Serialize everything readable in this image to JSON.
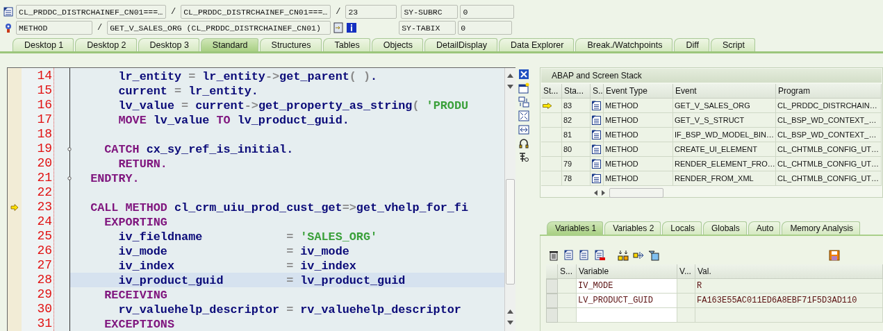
{
  "header_rows": [
    {
      "cells": [
        {
          "kind": "field",
          "text": "CL_PRDDC_DISTRCHAINEF_CN01===…"
        },
        {
          "kind": "separator",
          "text": "/"
        },
        {
          "kind": "field",
          "text": "CL_PRDDC_DISTRCHAINEF_CN01===…"
        },
        {
          "kind": "separator",
          "text": "/"
        },
        {
          "kind": "numberfield",
          "text": "23"
        }
      ],
      "sys_name": "SY-SUBRC",
      "sys_value": "0"
    },
    {
      "cells": [
        {
          "kind": "shortfield",
          "text": "METHOD"
        },
        {
          "kind": "separator",
          "text": "/"
        },
        {
          "kind": "longfield",
          "text": "GET_V_SALES_ORG (CL_PRDDC_DISTRCHAINEF_CN01)"
        }
      ],
      "sys_name": "SY-TABIX",
      "sys_value": "0"
    }
  ],
  "desktop_tabs": [
    {
      "label": "Desktop 1",
      "selected": false
    },
    {
      "label": "Desktop 2",
      "selected": false
    },
    {
      "label": "Desktop 3",
      "selected": false
    },
    {
      "label": "Standard",
      "selected": true
    },
    {
      "label": "Structures",
      "selected": false
    },
    {
      "label": "Tables",
      "selected": false
    },
    {
      "label": "Objects",
      "selected": false
    },
    {
      "label": "DetailDisplay",
      "selected": false
    },
    {
      "label": "Data Explorer",
      "selected": false
    },
    {
      "label": "Break./Watchpoints",
      "selected": false
    },
    {
      "label": "Diff",
      "selected": false
    },
    {
      "label": "Script",
      "selected": false
    }
  ],
  "code_lines": [
    {
      "number": "14",
      "current": false,
      "selected": false,
      "fold": false,
      "tokens": [
        {
          "kind": "id",
          "text": "      lr_entity "
        },
        {
          "kind": "op",
          "text": "= "
        },
        {
          "kind": "id",
          "text": "lr_entity"
        },
        {
          "kind": "op",
          "text": "->"
        },
        {
          "kind": "id",
          "text": "get_parent"
        },
        {
          "kind": "op",
          "text": "( )"
        },
        {
          "kind": "id",
          "text": "."
        }
      ]
    },
    {
      "number": "15",
      "current": false,
      "selected": false,
      "fold": false,
      "tokens": [
        {
          "kind": "id",
          "text": "      current "
        },
        {
          "kind": "op",
          "text": "= "
        },
        {
          "kind": "id",
          "text": "lr_entity."
        }
      ]
    },
    {
      "number": "16",
      "current": false,
      "selected": false,
      "fold": false,
      "tokens": [
        {
          "kind": "id",
          "text": "      lv_value "
        },
        {
          "kind": "op",
          "text": "= "
        },
        {
          "kind": "id",
          "text": "current"
        },
        {
          "kind": "op",
          "text": "->"
        },
        {
          "kind": "id",
          "text": "get_property_as_string"
        },
        {
          "kind": "op",
          "text": "( "
        },
        {
          "kind": "str",
          "text": "'PRODU"
        }
      ]
    },
    {
      "number": "17",
      "current": false,
      "selected": false,
      "fold": false,
      "tokens": [
        {
          "kind": "kw",
          "text": "      MOVE "
        },
        {
          "kind": "id",
          "text": "lv_value "
        },
        {
          "kind": "kw",
          "text": "TO "
        },
        {
          "kind": "id",
          "text": "lv_product_guid."
        }
      ]
    },
    {
      "number": "18",
      "current": false,
      "selected": false,
      "fold": false
    },
    {
      "number": "19",
      "current": false,
      "selected": false,
      "fold": true,
      "tokens": [
        {
          "kind": "kw",
          "text": "    CATCH "
        },
        {
          "kind": "id",
          "text": "cx_sy_ref_is_initial."
        }
      ]
    },
    {
      "number": "20",
      "current": false,
      "selected": false,
      "fold": false,
      "tokens": [
        {
          "kind": "kw",
          "text": "      RETURN."
        }
      ]
    },
    {
      "number": "21",
      "current": false,
      "selected": false,
      "fold": true,
      "tokens": [
        {
          "kind": "kw",
          "text": "  ENDTRY."
        }
      ]
    },
    {
      "number": "22",
      "current": false,
      "selected": false,
      "fold": false
    },
    {
      "number": "23",
      "current": true,
      "selected": false,
      "fold": false,
      "tokens": [
        {
          "kind": "kw",
          "text": "  CALL METHOD "
        },
        {
          "kind": "id",
          "text": "cl_crm_uiu_prod_cust_get"
        },
        {
          "kind": "op",
          "text": "=>"
        },
        {
          "kind": "id",
          "text": "get_vhelp_for_fi"
        }
      ]
    },
    {
      "number": "24",
      "current": false,
      "selected": false,
      "fold": false,
      "tokens": [
        {
          "kind": "kw",
          "text": "    EXPORTING"
        }
      ]
    },
    {
      "number": "25",
      "current": false,
      "selected": false,
      "fold": false,
      "tokens": [
        {
          "kind": "id",
          "text": "      iv_fieldname            "
        },
        {
          "kind": "op",
          "text": "= "
        },
        {
          "kind": "str",
          "text": "'SALES_ORG'"
        }
      ]
    },
    {
      "number": "26",
      "current": false,
      "selected": false,
      "fold": false,
      "tokens": [
        {
          "kind": "id",
          "text": "      iv_mode                 "
        },
        {
          "kind": "op",
          "text": "= "
        },
        {
          "kind": "id",
          "text": "iv_mode"
        }
      ]
    },
    {
      "number": "27",
      "current": false,
      "selected": false,
      "fold": false,
      "tokens": [
        {
          "kind": "id",
          "text": "      iv_index                "
        },
        {
          "kind": "op",
          "text": "= "
        },
        {
          "kind": "id",
          "text": "iv_index"
        }
      ]
    },
    {
      "number": "28",
      "current": false,
      "selected": true,
      "fold": false,
      "tokens": [
        {
          "kind": "id",
          "text": "      iv_product_guid         "
        },
        {
          "kind": "op",
          "text": "= "
        },
        {
          "kind": "id",
          "text": "lv_product_guid"
        }
      ]
    },
    {
      "number": "29",
      "current": false,
      "selected": false,
      "fold": false,
      "tokens": [
        {
          "kind": "kw",
          "text": "    RECEIVING"
        }
      ]
    },
    {
      "number": "30",
      "current": false,
      "selected": false,
      "fold": false,
      "tokens": [
        {
          "kind": "id",
          "text": "      rv_valuehelp_descriptor "
        },
        {
          "kind": "op",
          "text": "= "
        },
        {
          "kind": "id",
          "text": "rv_valuehelp_descriptor"
        }
      ]
    },
    {
      "number": "31",
      "current": false,
      "selected": false,
      "fold": false,
      "tokens": [
        {
          "kind": "kw",
          "text": "    EXCEPTIONS"
        }
      ]
    }
  ],
  "stack": {
    "title": "ABAP and Screen Stack",
    "columns": [
      "St...",
      "Sta...",
      "S..",
      "Event Type",
      "Event",
      "Program"
    ],
    "rows": [
      {
        "current": true,
        "level": "83",
        "event_type": "METHOD",
        "event": "GET_V_SALES_ORG",
        "program": "CL_PRDDC_DISTRCHAIN…"
      },
      {
        "current": false,
        "level": "82",
        "event_type": "METHOD",
        "event": "GET_V_S_STRUCT",
        "program": "CL_BSP_WD_CONTEXT_…"
      },
      {
        "current": false,
        "level": "81",
        "event_type": "METHOD",
        "event": "IF_BSP_WD_MODEL_BIN…",
        "program": "CL_BSP_WD_CONTEXT_…"
      },
      {
        "current": false,
        "level": "80",
        "event_type": "METHOD",
        "event": "CREATE_UI_ELEMENT",
        "program": "CL_CHTMLB_CONFIG_UT…"
      },
      {
        "current": false,
        "level": "79",
        "event_type": "METHOD",
        "event": "RENDER_ELEMENT_FRO…",
        "program": "CL_CHTMLB_CONFIG_UT…"
      },
      {
        "current": false,
        "level": "78",
        "event_type": "METHOD",
        "event": "RENDER_FROM_XML",
        "program": "CL_CHTMLB_CONFIG_UT…"
      }
    ]
  },
  "variable_tabs": [
    {
      "label": "Variables 1",
      "selected": true
    },
    {
      "label": "Variables 2",
      "selected": false
    },
    {
      "label": "Locals",
      "selected": false
    },
    {
      "label": "Globals",
      "selected": false
    },
    {
      "label": "Auto",
      "selected": false
    },
    {
      "label": "Memory Analysis",
      "selected": false
    }
  ],
  "variables": {
    "columns": [
      "S...",
      "Variable",
      "V...",
      "Val."
    ],
    "rows": [
      {
        "variable": "IV_MODE",
        "value": "R"
      },
      {
        "variable": "LV_PRODUCT_GUID",
        "value": "FA163E55AC011ED6A8EBF71F5D3AD110"
      }
    ]
  }
}
